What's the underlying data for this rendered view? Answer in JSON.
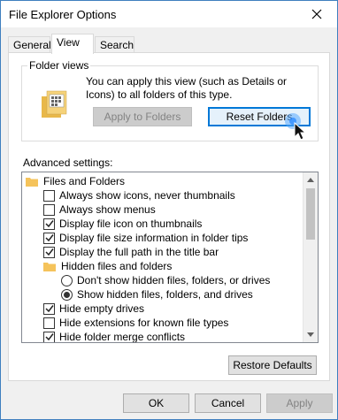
{
  "window": {
    "title": "File Explorer Options"
  },
  "tabs": [
    {
      "label": "General"
    },
    {
      "label": "View"
    },
    {
      "label": "Search"
    }
  ],
  "folder_views": {
    "title": "Folder views",
    "description": "You can apply this view (such as Details or Icons) to all folders of this type.",
    "apply_button": "Apply to Folders",
    "reset_button": "Reset Folders"
  },
  "advanced": {
    "label": "Advanced settings:",
    "items": [
      {
        "type": "folder",
        "label": "Files and Folders"
      },
      {
        "type": "checkbox",
        "label": "Always show icons, never thumbnails",
        "checked": false
      },
      {
        "type": "checkbox",
        "label": "Always show menus",
        "checked": false
      },
      {
        "type": "checkbox",
        "label": "Display file icon on thumbnails",
        "checked": true
      },
      {
        "type": "checkbox",
        "label": "Display file size information in folder tips",
        "checked": true
      },
      {
        "type": "checkbox",
        "label": "Display the full path in the title bar",
        "checked": true
      },
      {
        "type": "folder",
        "label": "Hidden files and folders"
      },
      {
        "type": "radio",
        "label": "Don't show hidden files, folders, or drives",
        "checked": false
      },
      {
        "type": "radio",
        "label": "Show hidden files, folders, and drives",
        "checked": true
      },
      {
        "type": "checkbox",
        "label": "Hide empty drives",
        "checked": true
      },
      {
        "type": "checkbox",
        "label": "Hide extensions for known file types",
        "checked": false
      },
      {
        "type": "checkbox",
        "label": "Hide folder merge conflicts",
        "checked": true
      }
    ],
    "restore_button": "Restore Defaults"
  },
  "footer": {
    "ok": "OK",
    "cancel": "Cancel",
    "apply": "Apply"
  },
  "colors": {
    "accent": "#0078d7",
    "folder": "#f5c35b"
  }
}
